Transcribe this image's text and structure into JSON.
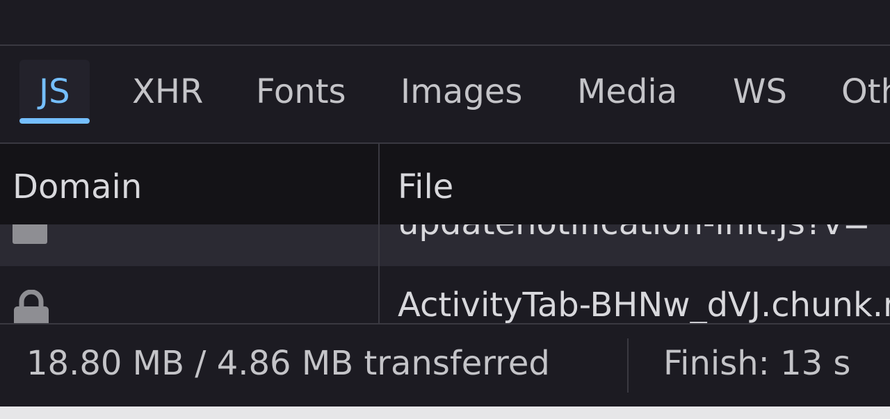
{
  "filter_tabs": [
    {
      "label": "JS",
      "active": true
    },
    {
      "label": "XHR",
      "active": false
    },
    {
      "label": "Fonts",
      "active": false
    },
    {
      "label": "Images",
      "active": false
    },
    {
      "label": "Media",
      "active": false
    },
    {
      "label": "WS",
      "active": false
    },
    {
      "label": "Other",
      "active": false
    }
  ],
  "columns": {
    "domain": "Domain",
    "file": "File"
  },
  "rows": [
    {
      "file": "updatenotification-init.js?v=",
      "icon": "folder-icon"
    },
    {
      "file": "ActivityTab-BHNw_dVJ.chunk.mjs",
      "icon": "lock-icon"
    }
  ],
  "status": {
    "transferred": "18.80 MB / 4.86 MB transferred",
    "finish": "Finish: 13 s"
  },
  "colors": {
    "accent": "#75bfff",
    "background": "#1c1b22",
    "header_background": "#141317",
    "selected_row": "#2b2a33",
    "text": "#d8d8dc"
  }
}
